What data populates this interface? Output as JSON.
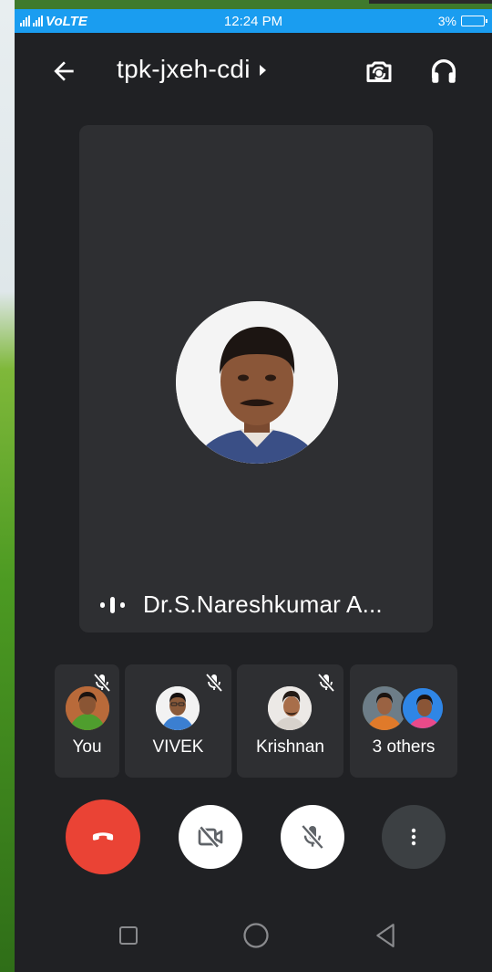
{
  "status_bar": {
    "network": "VoLTE",
    "time": "12:24 PM",
    "battery": "3%"
  },
  "header": {
    "meeting_code": "tpk-jxeh-cdi",
    "back_icon": "arrow-left-icon",
    "switch_camera_icon": "switch-camera-icon",
    "audio_icon": "headphones-icon"
  },
  "main_speaker": {
    "name": "Dr.S.Nareshkumar A...",
    "speaking_icon": "speaking-indicator-icon"
  },
  "participants": [
    {
      "label": "You",
      "muted": true
    },
    {
      "label": "VIVEK",
      "muted": true
    },
    {
      "label": "Krishnan",
      "muted": true
    },
    {
      "label": "3 others",
      "muted": false
    }
  ],
  "controls": {
    "end_call_icon": "phone-hangup-icon",
    "camera_icon": "video-off-icon",
    "mic_icon": "mic-off-icon",
    "more_icon": "more-vertical-icon"
  },
  "colors": {
    "status_bar": "#1a9df0",
    "background": "#202124",
    "tile": "#2e2f32",
    "end_call": "#ea4335"
  },
  "nav": {
    "recent_icon": "square-icon",
    "home_icon": "circle-icon",
    "back_icon": "triangle-back-icon"
  }
}
